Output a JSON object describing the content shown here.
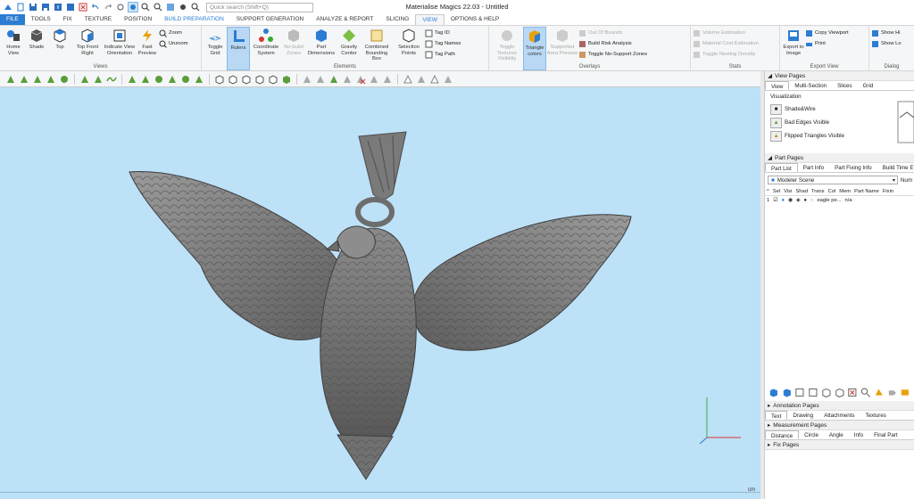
{
  "window": {
    "title": "Materialise Magics 22.03 - Untitled"
  },
  "search": {
    "placeholder": "Quick search (Shift+Q)"
  },
  "tabs": [
    {
      "label": "FILE"
    },
    {
      "label": "TOOLS"
    },
    {
      "label": "FIX"
    },
    {
      "label": "TEXTURE"
    },
    {
      "label": "POSITION"
    },
    {
      "label": "BUILD PREPARATION"
    },
    {
      "label": "SUPPORT GENERATION"
    },
    {
      "label": "ANALYZE & REPORT"
    },
    {
      "label": "SLICING"
    },
    {
      "label": "VIEW"
    },
    {
      "label": "OPTIONS & HELP"
    }
  ],
  "ribbon": {
    "views": {
      "name": "Views",
      "home": "Home View",
      "shade": "Shade",
      "top": "Top",
      "top_front_right": "Top Front Right",
      "indicate": "Indicate View Orientation",
      "fast": "Fast Preview",
      "zoom": "Zoom",
      "unzoom": "Unzoom"
    },
    "elements": {
      "name": "Elements",
      "toggle_grid": "Toggle Grid",
      "rulers": "Rulers",
      "coord": "Coordinate System",
      "nobuild": "No-build Zones",
      "dims": "Part Dimensions",
      "gravity": "Gravity Center",
      "bbox": "Combined Bounding Box",
      "selpts": "Selection Points",
      "tag_id": "Tag ID",
      "tag_names": "Tag Names",
      "tag_path": "Tag Path"
    },
    "overlays": {
      "name": "Overlays",
      "tex_vis": "Toggle Textures Visibility",
      "tri_colors": "Triangle colors",
      "supp_prev": "Supported Area Preview",
      "oob": "Out Of Bounds",
      "risk": "Build Risk Analysis",
      "nosupport": "Toggle No-Support Zones"
    },
    "stats": {
      "name": "Stats",
      "vol": "Volume Estimation",
      "cost": "Material Cost Estimation",
      "nest": "Toggle Nesting Density"
    },
    "export_view": {
      "name": "Export View",
      "export_img": "Export to Image",
      "copy": "Copy Viewport",
      "print": "Print"
    },
    "dialog": {
      "name": "Dialog",
      "show_hi": "Show Hi",
      "show_lo": "Show Lo"
    }
  },
  "viewport": {
    "unit": "cm"
  },
  "panel": {
    "view_pages": "View Pages",
    "view_tabs": [
      "View",
      "Multi-Section",
      "Slices",
      "Grid"
    ],
    "visualization": "Visualization",
    "viz_items": [
      "Shade&Wire",
      "Bad Edges Visible",
      "Flipped Triangles Visible"
    ],
    "part_pages": "Part Pages",
    "part_tabs": [
      "Part List",
      "Part Info",
      "Part Fixing Info",
      "Build Time E"
    ],
    "scene": "Modeler Scene",
    "num": "Num",
    "columns": [
      "^",
      "Sel",
      "Visi",
      "Shad",
      "Trans",
      "Col",
      "Mem",
      "Part Name",
      "Fixin"
    ],
    "rows": [
      {
        "index": "1",
        "name": "eagle pe...",
        "fix": "n/a"
      }
    ],
    "annotation_pages": "Annotation Pages",
    "annotation_tabs": [
      "Text",
      "Drawing",
      "Attachments",
      "Textures"
    ],
    "measurement_pages": "Measurement Pages",
    "measurement_tabs": [
      "Distance",
      "Circle",
      "Angle",
      "Info",
      "Final Part"
    ],
    "fix_pages": "Fix Pages"
  },
  "colors": {
    "accent": "#2b7cd3",
    "viewport_bg": "#bde1f7",
    "model": "#7d7d7d"
  }
}
